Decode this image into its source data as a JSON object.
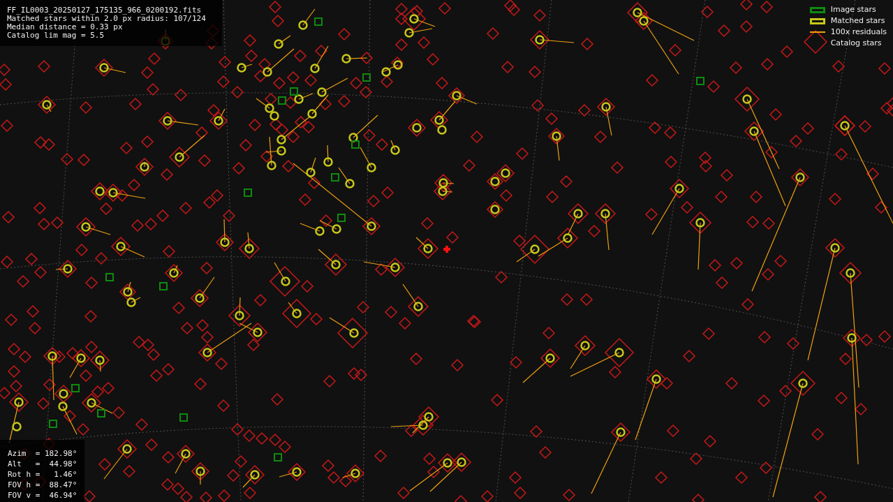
{
  "info": {
    "lines": [
      "FF_IL0003_20250127_175135_966_0200192.fits",
      "Matched stars within 2.0 px radius: 107/124",
      "Median distance = 0.33 px",
      "Catalog lim mag = 5.5"
    ]
  },
  "legend": [
    {
      "kind": "image",
      "label": "Image stars"
    },
    {
      "kind": "matched",
      "label": "Matched stars"
    },
    {
      "kind": "residual",
      "label": "100x residuals"
    },
    {
      "kind": "catalog",
      "label": "Catalog stars"
    }
  ],
  "pointing": {
    "lines": [
      "Azim  = 182.98°",
      "Alt   =  44.98°",
      "Rot h =   1.46°",
      "FOV h =  88.47°",
      "FOV v =  46.94°"
    ]
  }
}
